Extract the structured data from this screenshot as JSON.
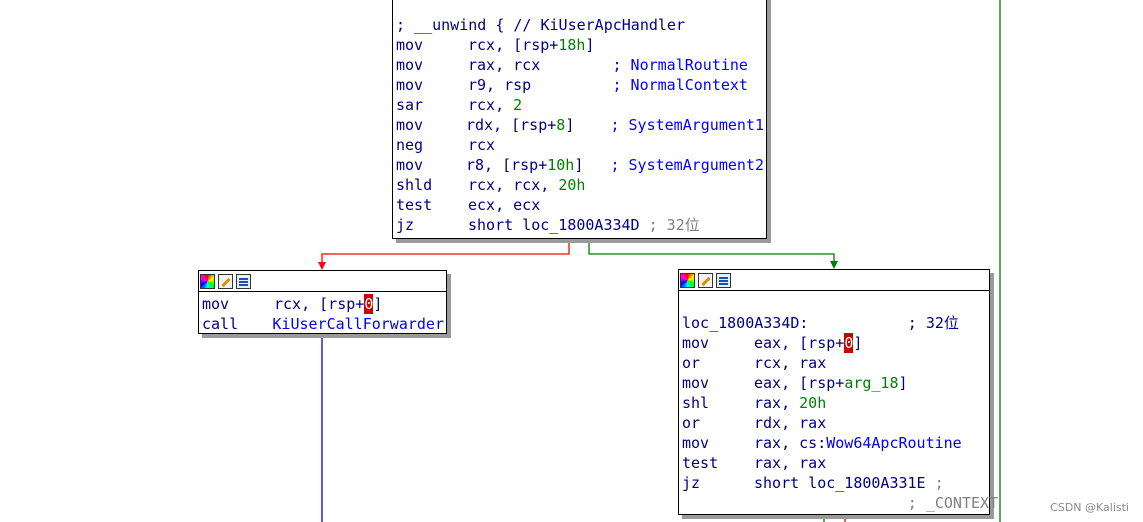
{
  "blocks": {
    "top": {
      "lines": [
        {
          "label": "; __unwind { // KiUserApcHandler"
        },
        {
          "mn": "mov",
          "ops": [
            {
              "t": "rcx, [rsp+"
            },
            {
              "t": "18h",
              "c": "num"
            },
            {
              "t": "]"
            }
          ]
        },
        {
          "mn": "mov",
          "ops": [
            {
              "t": "rax, rcx        "
            },
            {
              "t": "; NormalRoutine",
              "c": "cmt"
            }
          ]
        },
        {
          "mn": "mov",
          "ops": [
            {
              "t": "r9, rsp         "
            },
            {
              "t": "; NormalContext",
              "c": "cmt"
            }
          ]
        },
        {
          "mn": "sar",
          "ops": [
            {
              "t": "rcx, "
            },
            {
              "t": "2",
              "c": "num"
            }
          ]
        },
        {
          "mn": "mov",
          "ops": [
            {
              "t": "rdx, [rsp+"
            },
            {
              "t": "8",
              "c": "num"
            },
            {
              "t": "]    "
            },
            {
              "t": "; SystemArgument1",
              "c": "cmt"
            }
          ]
        },
        {
          "mn": "neg",
          "ops": [
            {
              "t": "rcx"
            }
          ]
        },
        {
          "mn": "mov",
          "ops": [
            {
              "t": "r8, [rsp+"
            },
            {
              "t": "10h",
              "c": "num"
            },
            {
              "t": "]   "
            },
            {
              "t": "; SystemArgument2",
              "c": "cmt"
            }
          ]
        },
        {
          "mn": "shld",
          "ops": [
            {
              "t": "rcx, rcx, "
            },
            {
              "t": "20h",
              "c": "num"
            }
          ]
        },
        {
          "mn": "test",
          "ops": [
            {
              "t": "ecx, ecx"
            }
          ]
        },
        {
          "mn": "jz",
          "ops": [
            {
              "t": "short loc_1800A334D "
            },
            {
              "t": "; 32位",
              "c": "gray"
            }
          ]
        }
      ]
    },
    "left": {
      "lines": [
        {
          "mn": "mov",
          "ops": [
            {
              "t": "rcx, [rsp+"
            },
            {
              "t": "0",
              "c": "hl"
            },
            {
              "t": "]"
            }
          ]
        },
        {
          "mn": "call",
          "ops": [
            {
              "t": "KiUserCallForwarder",
              "c": "sym"
            }
          ]
        }
      ]
    },
    "right": {
      "lines": [
        {
          "label": ""
        },
        {
          "label": "loc_1800A334D:           ; 32位"
        },
        {
          "mn": "mov",
          "ops": [
            {
              "t": "eax, [rsp+"
            },
            {
              "t": "0",
              "c": "hl"
            },
            {
              "t": "]"
            }
          ]
        },
        {
          "mn": "or",
          "ops": [
            {
              "t": "rcx, rax"
            }
          ]
        },
        {
          "mn": "mov",
          "ops": [
            {
              "t": "eax, [rsp+"
            },
            {
              "t": "arg_18",
              "c": "num"
            },
            {
              "t": "]"
            }
          ]
        },
        {
          "mn": "shl",
          "ops": [
            {
              "t": "rax, "
            },
            {
              "t": "20h",
              "c": "num"
            }
          ]
        },
        {
          "mn": "or",
          "ops": [
            {
              "t": "rdx, rax"
            }
          ]
        },
        {
          "mn": "mov",
          "ops": [
            {
              "t": "rax, cs:"
            },
            {
              "t": "Wow64ApcRoutine",
              "c": "sym"
            }
          ]
        },
        {
          "mn": "test",
          "ops": [
            {
              "t": "rax, rax"
            }
          ]
        },
        {
          "mn": "jz",
          "ops": [
            {
              "t": "short loc_1800A331E "
            },
            {
              "t": ";",
              "c": "gray"
            }
          ]
        },
        {
          "label": "                         ; _CONTEXT",
          "c": "gray"
        }
      ]
    }
  },
  "header_icons": [
    "color-palette-icon",
    "edit-pencil-icon",
    "graph-view-icon"
  ],
  "edge_colors": {
    "false_branch": "#ff0000",
    "true_branch": "#008000",
    "flow": "#0000ff"
  },
  "watermark": "CSDN @Kalisti"
}
